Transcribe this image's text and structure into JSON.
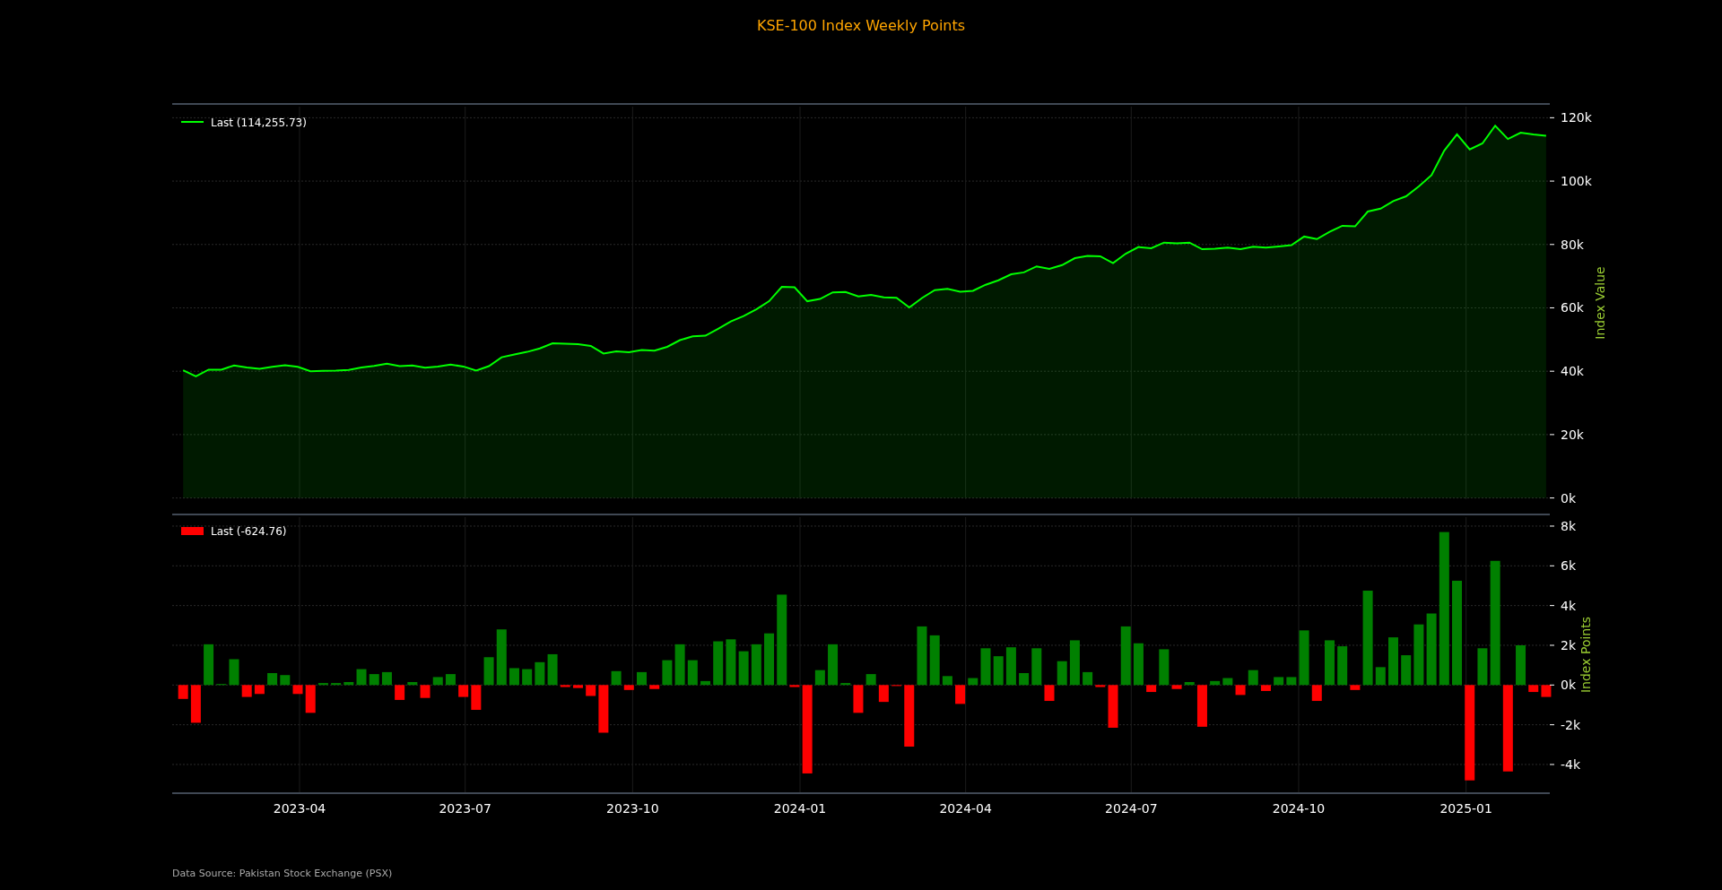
{
  "title": "KSE-100 Index Weekly Points",
  "index_chart": {
    "chart_data": {
      "type": "area",
      "ylabel": "Index Value",
      "grid": true,
      "x": [
        "2023-01-27",
        "2023-02-03",
        "2023-02-10",
        "2023-02-17",
        "2023-02-24",
        "2023-03-03",
        "2023-03-10",
        "2023-03-17",
        "2023-03-24",
        "2023-03-31",
        "2023-04-07",
        "2023-04-14",
        "2023-04-21",
        "2023-04-28",
        "2023-05-05",
        "2023-05-12",
        "2023-05-19",
        "2023-05-26",
        "2023-06-02",
        "2023-06-09",
        "2023-06-16",
        "2023-06-23",
        "2023-06-30",
        "2023-07-07",
        "2023-07-14",
        "2023-07-21",
        "2023-07-28",
        "2023-08-04",
        "2023-08-11",
        "2023-08-18",
        "2023-08-25",
        "2023-09-01",
        "2023-09-08",
        "2023-09-15",
        "2023-09-22",
        "2023-09-29",
        "2023-10-06",
        "2023-10-13",
        "2023-10-20",
        "2023-10-27",
        "2023-11-03",
        "2023-11-10",
        "2023-11-17",
        "2023-11-24",
        "2023-12-01",
        "2023-12-08",
        "2023-12-15",
        "2023-12-22",
        "2023-12-29",
        "2024-01-05",
        "2024-01-12",
        "2024-01-19",
        "2024-01-26",
        "2024-02-02",
        "2024-02-09",
        "2024-02-16",
        "2024-02-23",
        "2024-03-01",
        "2024-03-08",
        "2024-03-15",
        "2024-03-22",
        "2024-03-29",
        "2024-04-05",
        "2024-04-12",
        "2024-04-19",
        "2024-04-26",
        "2024-05-03",
        "2024-05-10",
        "2024-05-17",
        "2024-05-24",
        "2024-05-31",
        "2024-06-07",
        "2024-06-14",
        "2024-06-21",
        "2024-06-28",
        "2024-07-05",
        "2024-07-12",
        "2024-07-19",
        "2024-07-26",
        "2024-08-02",
        "2024-08-09",
        "2024-08-16",
        "2024-08-23",
        "2024-08-30",
        "2024-09-06",
        "2024-09-13",
        "2024-09-20",
        "2024-09-27",
        "2024-10-04",
        "2024-10-11",
        "2024-10-18",
        "2024-10-25",
        "2024-11-01",
        "2024-11-08",
        "2024-11-15",
        "2024-11-22",
        "2024-11-29",
        "2024-12-06",
        "2024-12-13",
        "2024-12-20",
        "2024-12-27",
        "2025-01-03",
        "2025-01-10",
        "2025-01-17",
        "2025-01-24",
        "2025-01-31",
        "2025-02-07",
        "2025-02-14"
      ],
      "series": [
        {
          "name": "Last (114,255.73)",
          "color": "#00ff00",
          "values": [
            40300,
            38400,
            40500,
            40500,
            41800,
            41200,
            40800,
            41400,
            41900,
            41400,
            40000,
            40100,
            40200,
            40400,
            41200,
            41700,
            42400,
            41600,
            41800,
            41100,
            41500,
            42100,
            41500,
            40200,
            41600,
            44400,
            45300,
            46100,
            47200,
            48800,
            48700,
            48500,
            48000,
            45600,
            46300,
            46000,
            46700,
            46500,
            47700,
            49800,
            51000,
            51200,
            53400,
            55700,
            57400,
            59500,
            62100,
            66600,
            66500,
            62100,
            62800,
            64900,
            65000,
            63600,
            64100,
            63300,
            63200,
            60100,
            63100,
            65600,
            66000,
            65100,
            65400,
            67300,
            68700,
            70600,
            71200,
            73100,
            72300,
            73500,
            75700,
            76400,
            76300,
            74100,
            77100,
            79200,
            78800,
            80600,
            80400,
            80600,
            78500,
            78700,
            79000,
            78500,
            79300,
            79000,
            79400,
            79800,
            82500,
            81700,
            84000,
            85900,
            85700,
            90400,
            91300,
            93700,
            95200,
            98300,
            101900,
            109600,
            114800,
            110000,
            111900,
            117500,
            113300,
            115300,
            114700,
            114300
          ]
        }
      ],
      "xlim": [
        "2023-01-21",
        "2025-02-16"
      ],
      "ylim": [
        -400,
        123500
      ],
      "yticks": [
        {
          "value": 0,
          "label": "0k"
        },
        {
          "value": 20000,
          "label": "20k"
        },
        {
          "value": 40000,
          "label": "40k"
        },
        {
          "value": 60000,
          "label": "60k"
        },
        {
          "value": 80000,
          "label": "80k"
        },
        {
          "value": 100000,
          "label": "100k"
        },
        {
          "value": 120000,
          "label": "120k"
        }
      ]
    }
  },
  "points_chart": {
    "chart_data": {
      "type": "bar",
      "ylabel": "Index Points",
      "grid": true,
      "x": [
        "2023-01-27",
        "2023-02-03",
        "2023-02-10",
        "2023-02-17",
        "2023-02-24",
        "2023-03-03",
        "2023-03-10",
        "2023-03-17",
        "2023-03-24",
        "2023-03-31",
        "2023-04-07",
        "2023-04-14",
        "2023-04-21",
        "2023-04-28",
        "2023-05-05",
        "2023-05-12",
        "2023-05-19",
        "2023-05-26",
        "2023-06-02",
        "2023-06-09",
        "2023-06-16",
        "2023-06-23",
        "2023-06-30",
        "2023-07-07",
        "2023-07-14",
        "2023-07-21",
        "2023-07-28",
        "2023-08-04",
        "2023-08-11",
        "2023-08-18",
        "2023-08-25",
        "2023-09-01",
        "2023-09-08",
        "2023-09-15",
        "2023-09-22",
        "2023-09-29",
        "2023-10-06",
        "2023-10-13",
        "2023-10-20",
        "2023-10-27",
        "2023-11-03",
        "2023-11-10",
        "2023-11-17",
        "2023-11-24",
        "2023-12-01",
        "2023-12-08",
        "2023-12-15",
        "2023-12-22",
        "2023-12-29",
        "2024-01-05",
        "2024-01-12",
        "2024-01-19",
        "2024-01-26",
        "2024-02-02",
        "2024-02-09",
        "2024-02-16",
        "2024-02-23",
        "2024-03-01",
        "2024-03-08",
        "2024-03-15",
        "2024-03-22",
        "2024-03-29",
        "2024-04-05",
        "2024-04-12",
        "2024-04-19",
        "2024-04-26",
        "2024-05-03",
        "2024-05-10",
        "2024-05-17",
        "2024-05-24",
        "2024-05-31",
        "2024-06-07",
        "2024-06-14",
        "2024-06-21",
        "2024-06-28",
        "2024-07-05",
        "2024-07-12",
        "2024-07-19",
        "2024-07-26",
        "2024-08-02",
        "2024-08-09",
        "2024-08-16",
        "2024-08-23",
        "2024-08-30",
        "2024-09-06",
        "2024-09-13",
        "2024-09-20",
        "2024-09-27",
        "2024-10-04",
        "2024-10-11",
        "2024-10-18",
        "2024-10-25",
        "2024-11-01",
        "2024-11-08",
        "2024-11-15",
        "2024-11-22",
        "2024-11-29",
        "2024-12-06",
        "2024-12-13",
        "2024-12-20",
        "2024-12-27",
        "2025-01-03",
        "2025-01-10",
        "2025-01-17",
        "2025-01-24",
        "2025-01-31",
        "2025-02-07",
        "2025-02-14"
      ],
      "series": [
        {
          "color": "#008000",
          "values": [
            null,
            null,
            2050,
            50,
            1300,
            null,
            null,
            600,
            500,
            null,
            null,
            100,
            100,
            150,
            800,
            550,
            650,
            null,
            150,
            null,
            400,
            550,
            null,
            null,
            1400,
            2800,
            850,
            800,
            1150,
            1550,
            null,
            null,
            null,
            null,
            700,
            null,
            650,
            null,
            1250,
            2050,
            1250,
            200,
            2200,
            2300,
            1700,
            2050,
            2600,
            4550,
            null,
            null,
            750,
            2050,
            100,
            null,
            550,
            null,
            null,
            null,
            2950,
            2500,
            450,
            null,
            350,
            1850,
            1450,
            1900,
            600,
            1850,
            null,
            1200,
            2250,
            650,
            null,
            null,
            2950,
            2100,
            null,
            1800,
            null,
            150,
            null,
            200,
            350,
            null,
            750,
            null,
            400,
            400,
            2750,
            null,
            2250,
            1950,
            null,
            4750,
            900,
            2400,
            1500,
            3050,
            3600,
            7700,
            5250,
            null,
            1850,
            6250,
            null,
            2000,
            null,
            null
          ]
        },
        {
          "name": "Last (-624.76)",
          "color": "#ff0000",
          "values": [
            -700,
            -1900,
            null,
            null,
            null,
            -600,
            -450,
            null,
            null,
            -450,
            -1400,
            null,
            null,
            null,
            null,
            null,
            null,
            -750,
            null,
            -650,
            null,
            null,
            -600,
            -1250,
            null,
            null,
            null,
            null,
            null,
            null,
            -100,
            -150,
            -550,
            -2400,
            null,
            -250,
            null,
            -200,
            null,
            null,
            null,
            null,
            null,
            null,
            null,
            null,
            null,
            null,
            -100,
            -4450,
            null,
            null,
            null,
            -1400,
            null,
            -850,
            -50,
            -3100,
            null,
            null,
            null,
            -950,
            null,
            null,
            null,
            null,
            null,
            null,
            -800,
            null,
            null,
            null,
            -100,
            -2150,
            null,
            null,
            -350,
            null,
            -200,
            null,
            -2100,
            null,
            null,
            -500,
            null,
            -300,
            null,
            null,
            null,
            -800,
            null,
            null,
            -250,
            null,
            null,
            null,
            null,
            null,
            null,
            null,
            null,
            -4800,
            null,
            null,
            -4350,
            null,
            -350,
            -600
          ]
        }
      ],
      "xlim": [
        "2023-01-21",
        "2025-02-16"
      ],
      "ylim": [
        -5400,
        8450
      ],
      "xticks": [
        {
          "value": "2023-04-01",
          "label": "2023-04"
        },
        {
          "value": "2023-07-01",
          "label": "2023-07"
        },
        {
          "value": "2023-10-01",
          "label": "2023-10"
        },
        {
          "value": "2024-01-01",
          "label": "2024-01"
        },
        {
          "value": "2024-04-01",
          "label": "2024-04"
        },
        {
          "value": "2024-07-01",
          "label": "2024-07"
        },
        {
          "value": "2024-10-01",
          "label": "2024-10"
        },
        {
          "value": "2025-01-01",
          "label": "2025-01"
        }
      ],
      "yticks": [
        {
          "value": -4000,
          "label": "-4k"
        },
        {
          "value": -2000,
          "label": "-2k"
        },
        {
          "value": 0,
          "label": "0k"
        },
        {
          "value": 2000,
          "label": "2k"
        },
        {
          "value": 4000,
          "label": "4k"
        },
        {
          "value": 6000,
          "label": "6k"
        },
        {
          "value": 8000,
          "label": "8k"
        }
      ]
    }
  },
  "footer": "Data Source: Pakistan Stock Exchange (PSX)"
}
